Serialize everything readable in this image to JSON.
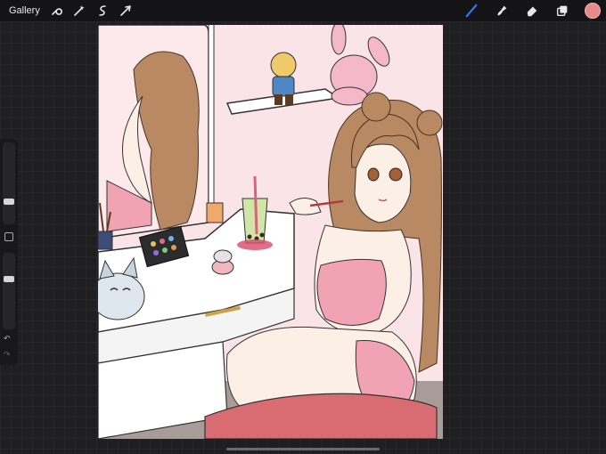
{
  "topbar": {
    "gallery_label": "Gallery",
    "left_tools": [
      "wrench-icon",
      "magic-wand-icon",
      "selection-icon",
      "transform-arrow-icon"
    ],
    "right_tools": [
      "brush-icon",
      "smudge-icon",
      "eraser-icon",
      "layers-icon"
    ],
    "active_tool": "brush-icon",
    "current_color": "#e98a8a"
  },
  "sidebar": {
    "brush_size": 0.35,
    "opacity": 0.3,
    "modify_button": "square-icon",
    "undo": "undo-arrow-icon",
    "redo": "redo-arrow-icon"
  },
  "artwork": {
    "palette": {
      "wall": "#fbe4e8",
      "hair": "#b88963",
      "skin": "#fcefe6",
      "pink": "#f2a3b3",
      "floor": "#a89c98"
    }
  }
}
